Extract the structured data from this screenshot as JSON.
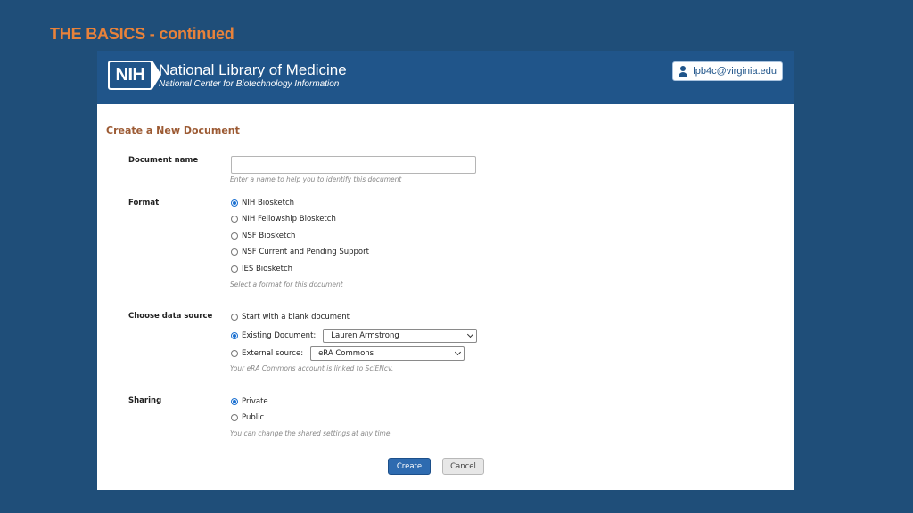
{
  "slide": {
    "title": "THE BASICS - continued"
  },
  "header": {
    "logo_text": "NIH",
    "library_name": "National Library of Medicine",
    "library_subtitle": "National Center for Biotechnology Information",
    "account": "lpb4c@virginia.edu"
  },
  "form": {
    "title": "Create a New Document",
    "document_name": {
      "label": "Document name",
      "value": "",
      "hint": "Enter a name to help you to identify this document"
    },
    "format": {
      "label": "Format",
      "options": [
        "NIH Biosketch",
        "NIH Fellowship Biosketch",
        "NSF Biosketch",
        "NSF Current and Pending Support",
        "IES Biosketch"
      ],
      "selected": "NIH Biosketch",
      "hint": "Select a format for this document"
    },
    "data_source": {
      "label": "Choose data source",
      "options": [
        "Start with a blank document",
        "Existing Document:",
        "External source:"
      ],
      "selected": "Existing Document:",
      "existing_document_value": "Lauren Armstrong",
      "external_source_value": "eRA Commons",
      "hint": "Your eRA Commons account is linked to SciENcv."
    },
    "sharing": {
      "label": "Sharing",
      "options": [
        "Private",
        "Public"
      ],
      "selected": "Private",
      "hint": "You can change the shared settings at any time."
    },
    "buttons": {
      "create": "Create",
      "cancel": "Cancel"
    }
  }
}
